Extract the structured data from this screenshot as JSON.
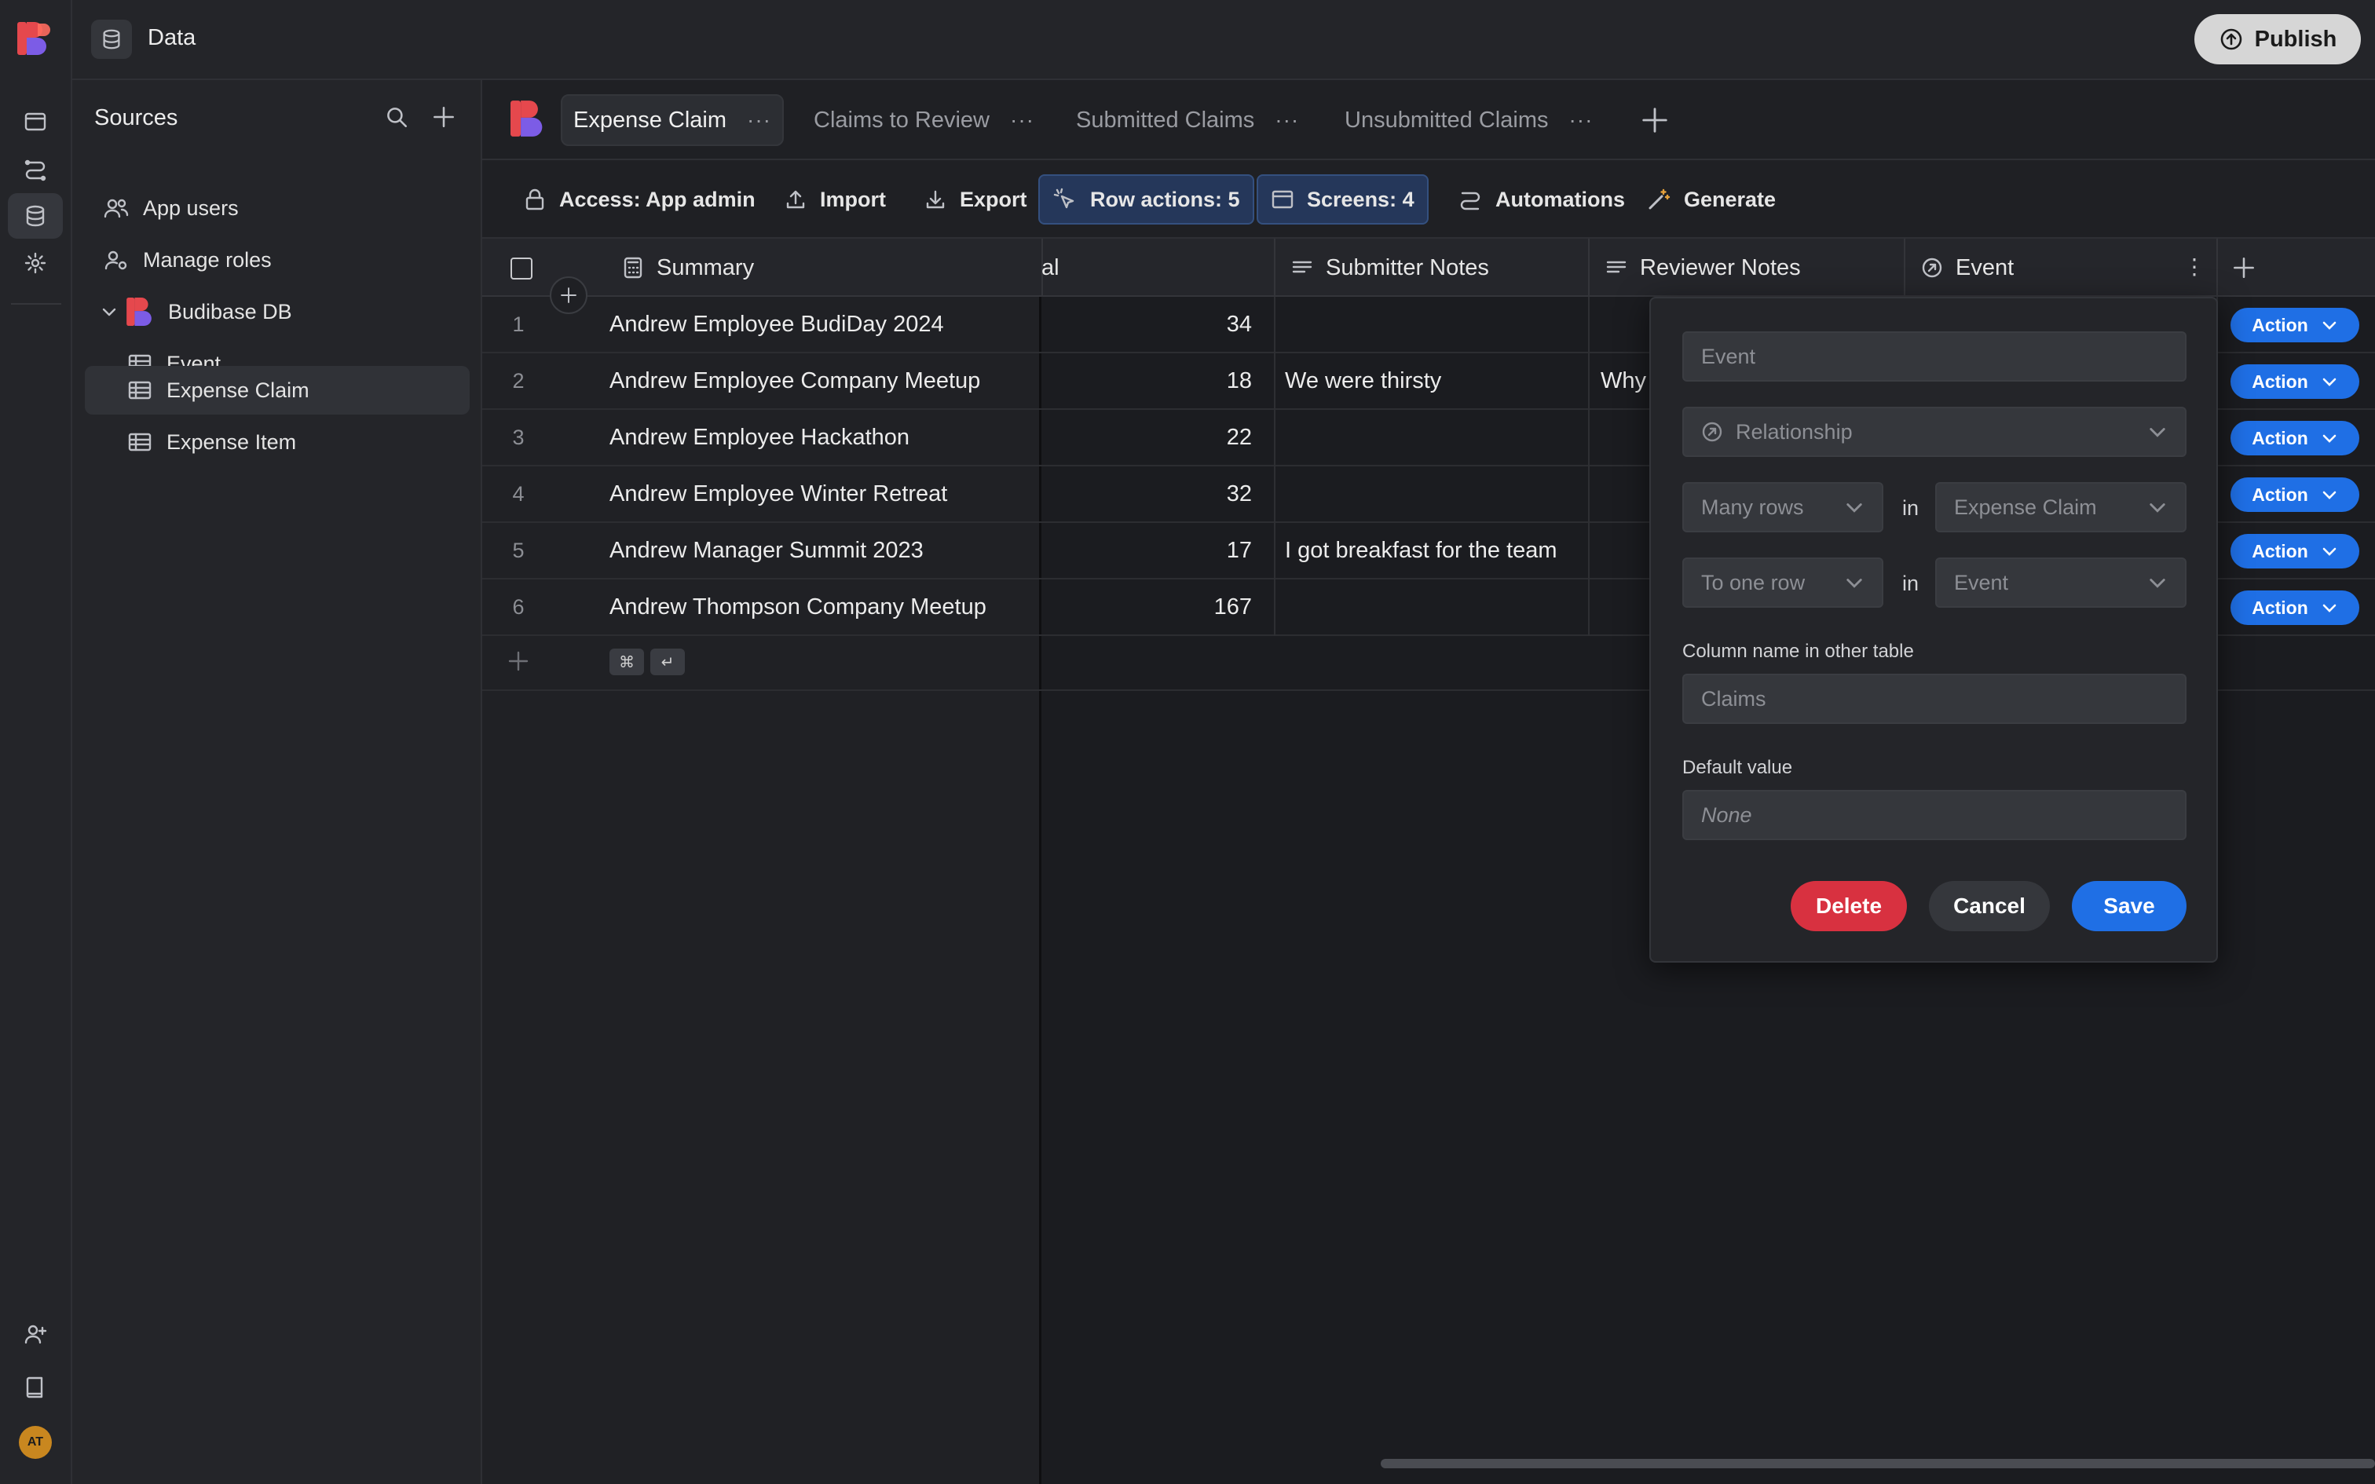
{
  "topbar": {
    "title": "Data",
    "publish_label": "Publish"
  },
  "sources": {
    "title": "Sources",
    "items": [
      {
        "label": "App users",
        "icon": "users-icon"
      },
      {
        "label": "Manage roles",
        "icon": "user-roles-icon"
      },
      {
        "label": "Budibase DB",
        "icon": "budibase-logo-icon"
      },
      {
        "label": "Event",
        "icon": "table-icon"
      },
      {
        "label": "Expense Claim",
        "icon": "table-icon",
        "active": true
      },
      {
        "label": "Expense Item",
        "icon": "table-icon"
      }
    ]
  },
  "tabs": [
    {
      "label": "Expense Claim",
      "active": true
    },
    {
      "label": "Claims to Review"
    },
    {
      "label": "Submitted Claims"
    },
    {
      "label": "Unsubmitted Claims"
    }
  ],
  "actions": {
    "access": "Access: App admin",
    "import": "Import",
    "export": "Export",
    "row_actions": "Row actions: 5",
    "screens": "Screens: 4",
    "automations": "Automations",
    "generate": "Generate"
  },
  "grid": {
    "columns": {
      "summary": "Summary",
      "total_partial": "al",
      "submitter_notes": "Submitter Notes",
      "reviewer_notes": "Reviewer Notes",
      "event": "Event"
    },
    "rows": [
      {
        "num": "1",
        "summary": "Andrew Employee BudiDay 2024",
        "total": "34",
        "submitter": "",
        "reviewer": ""
      },
      {
        "num": "2",
        "summary": "Andrew Employee Company Meetup",
        "total": "18",
        "submitter": "We were thirsty",
        "reviewer": "Why"
      },
      {
        "num": "3",
        "summary": "Andrew Employee Hackathon",
        "total": "22",
        "submitter": "",
        "reviewer": ""
      },
      {
        "num": "4",
        "summary": "Andrew Employee Winter Retreat",
        "total": "32",
        "submitter": "",
        "reviewer": ""
      },
      {
        "num": "5",
        "summary": "Andrew Manager Summit 2023",
        "total": "17",
        "submitter": "I got breakfast for the team",
        "reviewer": ""
      },
      {
        "num": "6",
        "summary": "Andrew Thompson Company Meetup",
        "total": "167",
        "submitter": "",
        "reviewer": ""
      }
    ],
    "action_label": "Action",
    "kbd_cmd": "⌘",
    "kbd_enter": "↵"
  },
  "popover": {
    "name_placeholder": "Event",
    "type": "Relationship",
    "many_rows": "Many rows",
    "in_1": "in",
    "table_1": "Expense Claim",
    "to_one_row": "To one row",
    "in_2": "in",
    "table_2": "Event",
    "other_col_label": "Column name in other table",
    "other_col_placeholder": "Claims",
    "default_label": "Default value",
    "default_placeholder": "None",
    "delete": "Delete",
    "cancel": "Cancel",
    "save": "Save"
  },
  "avatar": {
    "initials": "AT"
  },
  "colors": {
    "accent": "#1f6fe5",
    "danger": "#d83140",
    "active_bar": "#25375a"
  }
}
